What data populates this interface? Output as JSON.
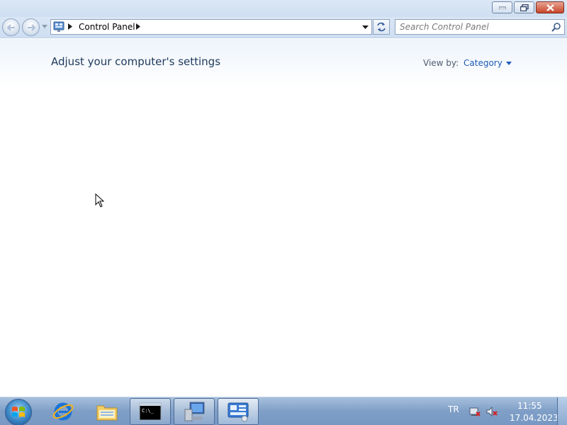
{
  "window": {
    "minimize_icon": "minimize-icon",
    "maximize_icon": "restore-icon",
    "close_icon": "close-icon"
  },
  "nav": {
    "address_path": "Control Panel",
    "search_placeholder": "Search Control Panel"
  },
  "content": {
    "title": "Adjust your computer's settings",
    "view_by_label": "View by:",
    "view_by_value": "Category"
  },
  "taskbar": {
    "items": [
      {
        "name": "Internet Explorer",
        "icon": "ie-icon"
      },
      {
        "name": "Windows Explorer",
        "icon": "folder-icon"
      },
      {
        "name": "Command Prompt",
        "icon": "cmd-icon"
      },
      {
        "name": "Computer",
        "icon": "computer-icon"
      },
      {
        "name": "Control Panel",
        "icon": "control-panel-icon"
      }
    ],
    "tray": {
      "language": "TR",
      "time": "11:55",
      "date": "17.04.2023"
    }
  },
  "colors": {
    "title_text": "#1e395b",
    "link": "#1e5bb8",
    "taskbar": "#7f9fc7"
  }
}
